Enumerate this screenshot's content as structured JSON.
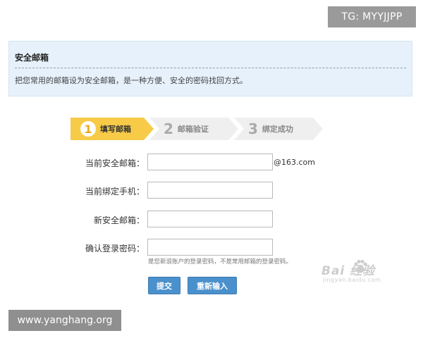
{
  "overlay": {
    "tg_label": "TG: MYYJJPP",
    "site_label": "www.yanghang.org"
  },
  "panel": {
    "title": "安全邮箱",
    "description": "把您常用的邮箱设为安全邮箱，是一种方便、安全的密码找回方式。"
  },
  "steps": [
    {
      "number": "1",
      "label": "填写邮箱",
      "active": true
    },
    {
      "number": "2",
      "label": "邮箱验证",
      "active": false
    },
    {
      "number": "3",
      "label": "绑定成功",
      "active": false
    }
  ],
  "form": {
    "current_email": {
      "label": "当前安全邮箱：",
      "value": "",
      "suffix": "@163.com"
    },
    "current_phone": {
      "label": "当前绑定手机：",
      "value": ""
    },
    "new_email": {
      "label": "新安全邮箱：",
      "value": ""
    },
    "confirm_password": {
      "label": "确认登录密码：",
      "value": ""
    },
    "hint": "是您新浪账户的登录密码，不是常用邮箱的登录密码。"
  },
  "buttons": {
    "submit": "提交",
    "reset": "重新输入"
  },
  "watermark": {
    "brand": "Bai 经验",
    "sub": "jingyan.baidu.com"
  },
  "colors": {
    "panel_bg": "#e6f1fb",
    "step_active": "#f7cb48",
    "step_inactive": "#efefef",
    "button_bg": "#4a90cc"
  }
}
